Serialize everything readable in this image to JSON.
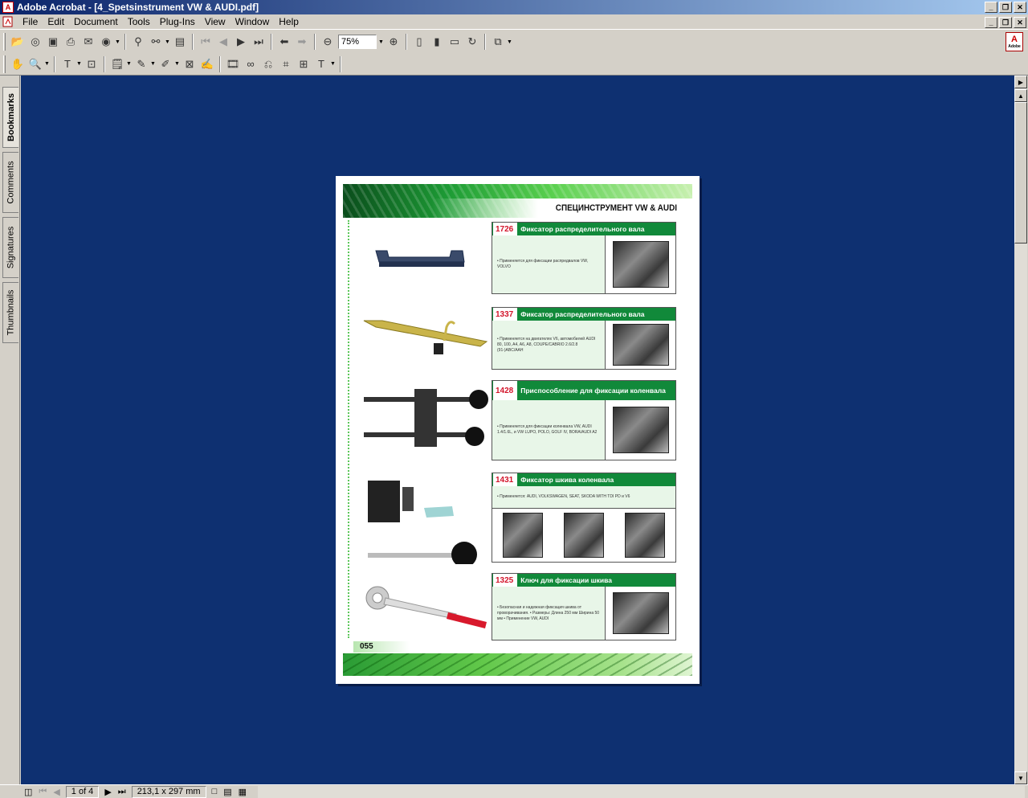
{
  "window": {
    "title": "Adobe Acrobat - [4_Spetsinstrument VW & AUDI.pdf]",
    "buttons": [
      "_",
      "❐",
      "✕"
    ]
  },
  "menu": [
    "File",
    "Edit",
    "Document",
    "Tools",
    "Plug-Ins",
    "View",
    "Window",
    "Help"
  ],
  "toolbar": {
    "zoom_value": "75%"
  },
  "nav_tabs": [
    "Bookmarks",
    "Comments",
    "Signatures",
    "Thumbnails"
  ],
  "status": {
    "page_indicator": "1 of 4",
    "page_size": "213,1 x 297 mm"
  },
  "pdf_page": {
    "header": "СПЕЦИНСТРУМЕНТ VW & AUDI",
    "page_number": "055",
    "items": [
      {
        "code": "1726",
        "title": "Фиксатор распределительного вала",
        "text": "• Применяется для фиксации распредвалов VW, VOLVO"
      },
      {
        "code": "1337",
        "title": "Фиксатор распределительного вала",
        "text": "• Применяется на двигателях V6, автомобилей AUDI 80, 100, A4, A6, A8, COUPE/CABRIO 2.6/2.8 (91-)ABC/AAH"
      },
      {
        "code": "1428",
        "title": "Приспособление для фиксации коленвала",
        "text": "• Применяется для фиксации коленвала VW, AUDI 1.4/1.6L, и VW LUPO, POLO, GOLF IV, BORA/AUDI A2"
      },
      {
        "code": "1431",
        "title": "Фиксатор шкива коленвала",
        "text": "• Применяется: AUDI, VOLKSWAGEN, SEAT, SKODA WITH TDI PD и V6"
      },
      {
        "code": "1325",
        "title": "Ключ для фиксации шкива",
        "text": "• Безопасная и надежная фиксация шкива от проворачивания. • Размеры: Длина 250 мм Ширина 50 мм • Применение VW, AUDI"
      }
    ]
  }
}
